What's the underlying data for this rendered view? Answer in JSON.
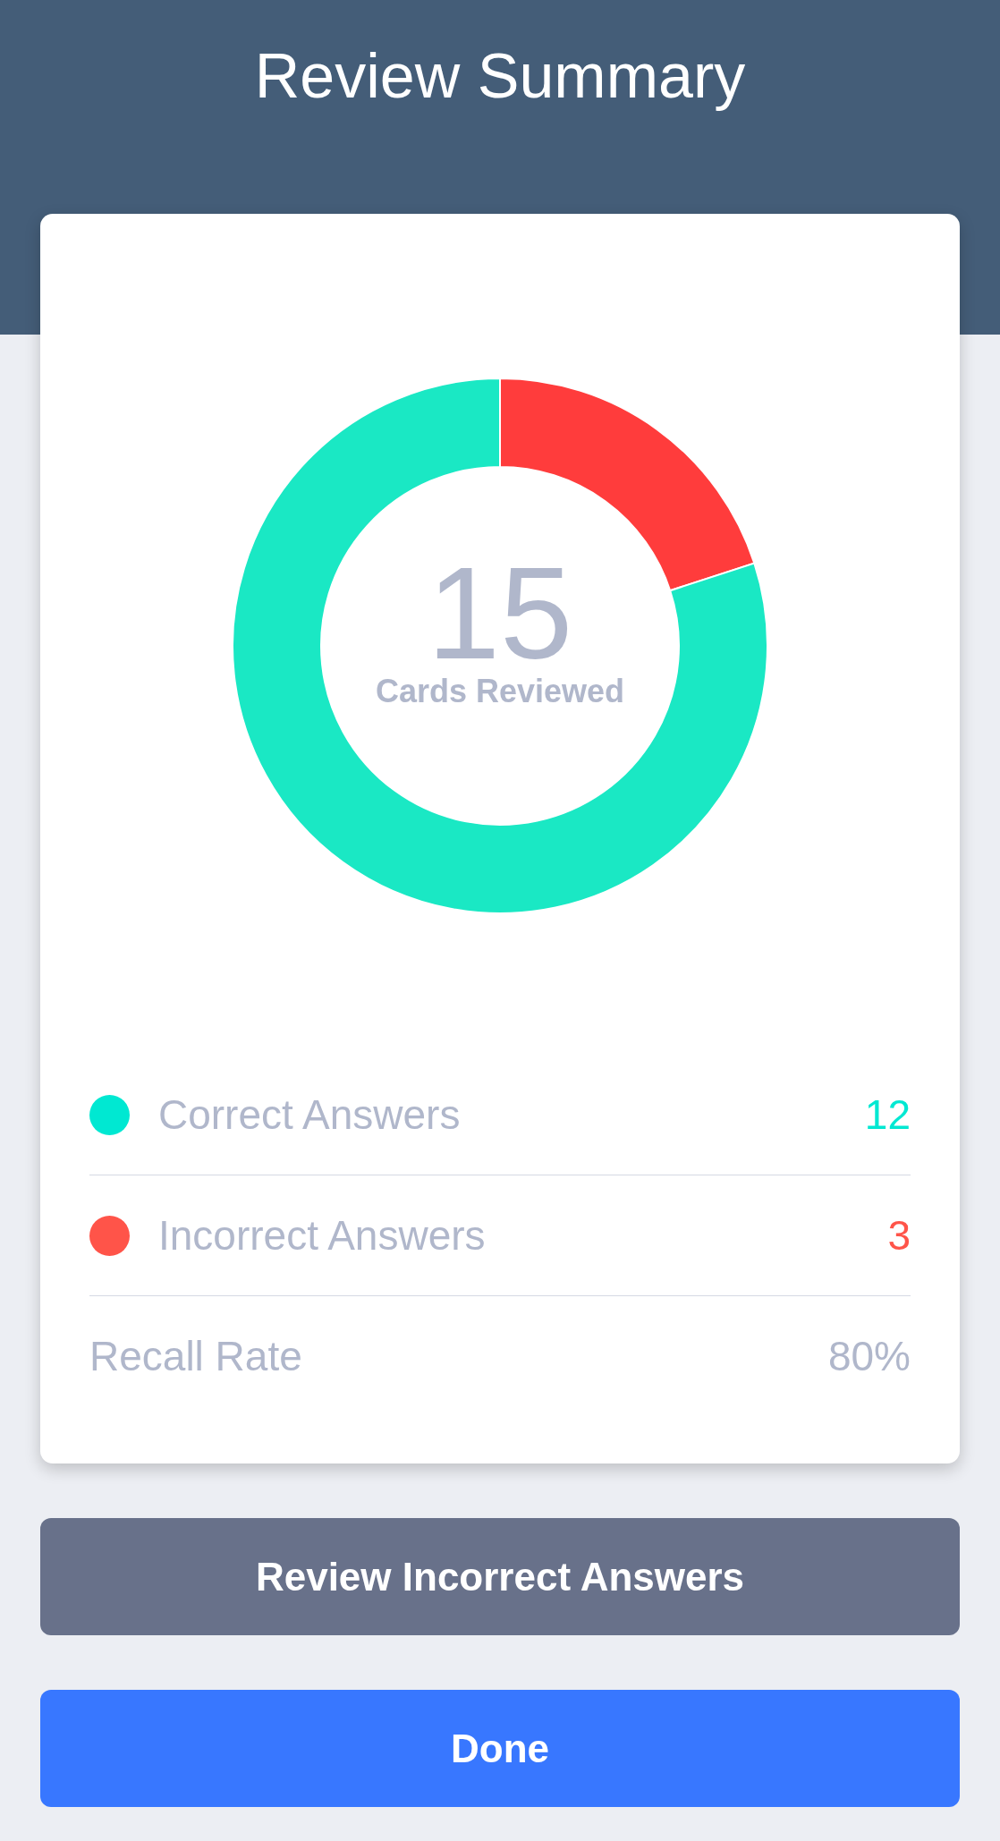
{
  "header": {
    "title": "Review Summary"
  },
  "summary_card": {
    "chart": {
      "total": "15",
      "caption": "Cards Reviewed",
      "chart_data": {
        "type": "donut",
        "values": [
          20,
          80
        ],
        "colors": [
          "#ff3c3c",
          "#1ae8c4"
        ]
      }
    },
    "stats": [
      {
        "kind": "answer",
        "label": "Correct Answers",
        "value": "12",
        "color": "#00e8d2"
      },
      {
        "kind": "answer",
        "label": "Incorrect Answers",
        "value": "3",
        "color": "#ff5449"
      },
      {
        "kind": "rate",
        "label": "Recall Rate",
        "value": "80%"
      }
    ]
  },
  "buttons": [
    {
      "kind": "secondary",
      "label": "Review Incorrect Answers"
    },
    {
      "kind": "primary",
      "label": "Done"
    }
  ]
}
